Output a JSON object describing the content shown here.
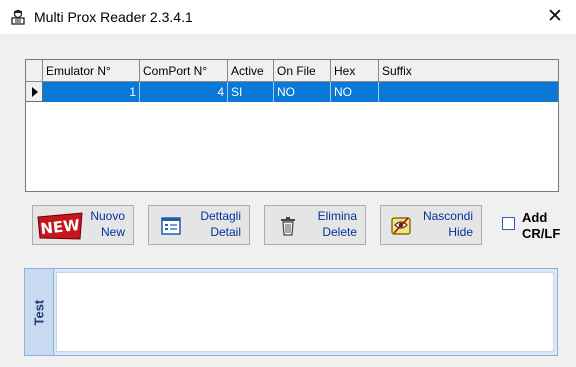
{
  "window": {
    "title": "Multi Prox Reader 2.3.4.1",
    "close_glyph": "✕"
  },
  "grid": {
    "columns": [
      "Emulator N°",
      "ComPort N°",
      "Active",
      "On File",
      "Hex",
      "Suffix"
    ],
    "rows": [
      {
        "emulator": "1",
        "comport": "4",
        "active": "SI",
        "on_file": "NO",
        "hex": "NO",
        "suffix": ""
      }
    ],
    "selection_color": "#0a78d7"
  },
  "buttons": {
    "new": {
      "line1": "Nuovo",
      "line2": "New",
      "icon": "new-icon"
    },
    "detail": {
      "line1": "Dettagli",
      "line2": "Detail",
      "icon": "detail-icon"
    },
    "delete": {
      "line1": "Elimina",
      "line2": "Delete",
      "icon": "trash-icon"
    },
    "hide": {
      "line1": "Nascondi",
      "line2": "Hide",
      "icon": "hide-icon"
    }
  },
  "add_crlf": {
    "line1": "Add",
    "line2": "CR/LF",
    "checked": false
  },
  "test_panel": {
    "tab_label": "Test",
    "content": ""
  }
}
